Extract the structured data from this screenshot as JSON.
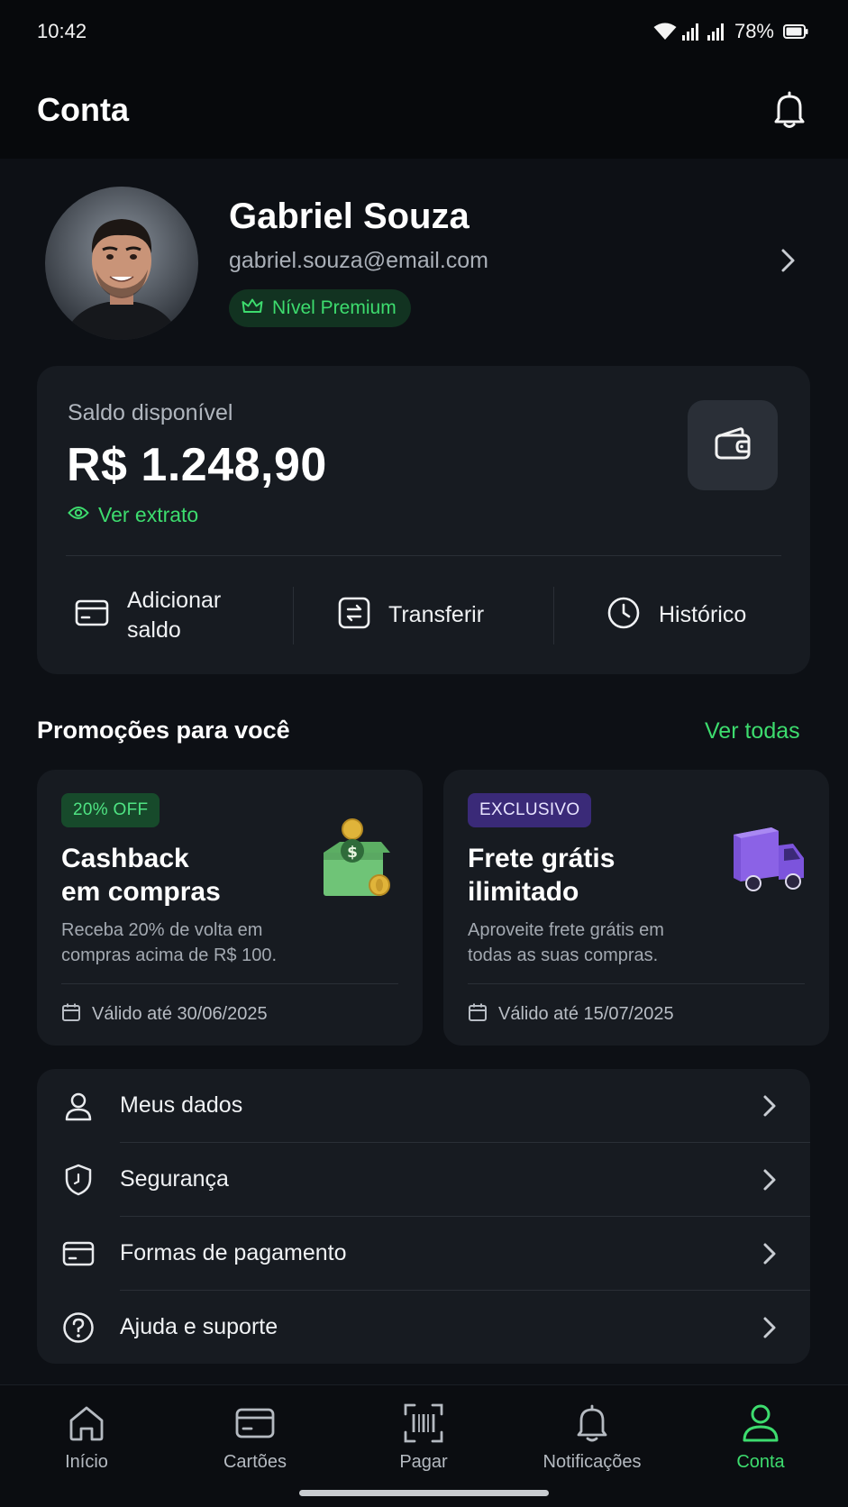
{
  "status_bar": {
    "time": "10:42",
    "battery_percent": "78%"
  },
  "header": {
    "title": "Conta",
    "notification_icon": "bell-icon"
  },
  "profile": {
    "name": "Gabriel Souza",
    "email": "gabriel.souza@email.com",
    "badge": "Nível Premium",
    "badge_icon": "crown-icon"
  },
  "balance": {
    "label": "Saldo disponível",
    "value": "R$ 1.248,90",
    "extract_link": "Ver extrato",
    "wallet_icon": "wallet-icon",
    "actions": [
      {
        "label_line1": "Adicionar",
        "label_line2": "saldo",
        "icon": "card-icon"
      },
      {
        "label": "Transferir",
        "icon": "transfer-icon"
      },
      {
        "label": "Histórico",
        "icon": "clock-icon"
      }
    ]
  },
  "promotions": {
    "title": "Promoções para você",
    "see_all": "Ver todas",
    "items": [
      {
        "badge": "20% OFF",
        "title_line1": "Cashback",
        "title_line2": "em compras",
        "desc_line1": "Receba 20% de volta em",
        "desc_line2": "compras acima de R$ 100.",
        "valid": "Válido até 30/06/2025",
        "art": "money-box-illustration"
      },
      {
        "badge": "EXCLUSIVO",
        "title_line1": "Frete grátis",
        "title_line2": "ilimitado",
        "desc_line1": "Aproveite frete grátis em",
        "desc_line2": "todas as suas compras.",
        "valid": "Válido até 15/07/2025",
        "art": "delivery-truck-illustration"
      }
    ]
  },
  "menu": {
    "items": [
      {
        "label": "Meus dados",
        "icon": "user-icon"
      },
      {
        "label": "Segurança",
        "icon": "shield-icon"
      },
      {
        "label": "Formas de pagamento",
        "icon": "credit-card-icon"
      },
      {
        "label": "Ajuda e suporte",
        "icon": "help-icon"
      }
    ]
  },
  "bottom_nav": {
    "items": [
      {
        "label": "Início",
        "icon": "home-icon",
        "active": false
      },
      {
        "label": "Cartões",
        "icon": "cards-icon",
        "active": false
      },
      {
        "label": "Pagar",
        "icon": "barcode-scan-icon",
        "active": false
      },
      {
        "label": "Notificações",
        "icon": "bell-icon",
        "active": false
      },
      {
        "label": "Conta",
        "icon": "profile-icon",
        "active": true
      }
    ]
  },
  "colors": {
    "background": "#0d1015",
    "card": "#171b21",
    "accent_green": "#3ddc6e",
    "badge_purple": "#3a2a78",
    "text_primary": "#ffffff",
    "text_secondary": "#aab0b8"
  }
}
